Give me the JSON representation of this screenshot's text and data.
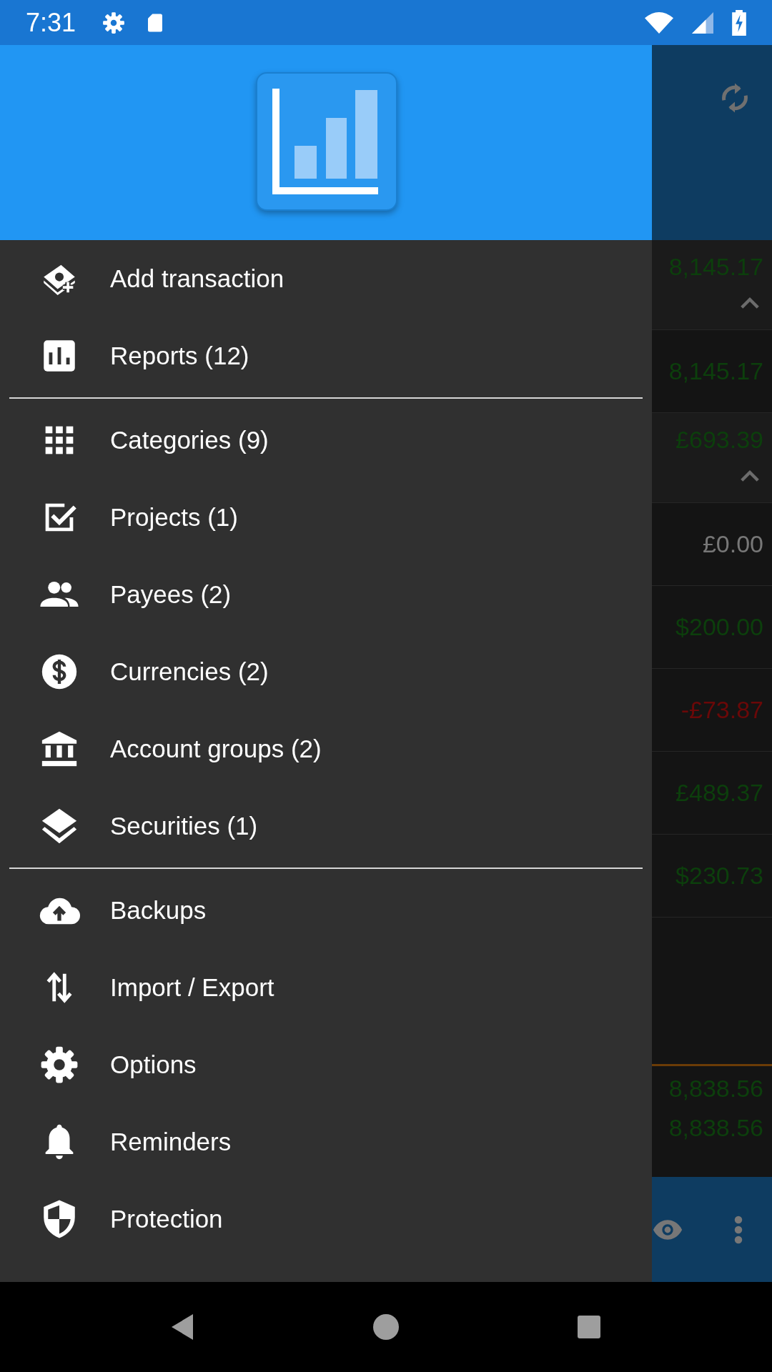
{
  "status_bar": {
    "time": "7:31"
  },
  "drawer": {
    "sections": [
      [
        {
          "label": "Add transaction"
        },
        {
          "label": "Reports (12)"
        }
      ],
      [
        {
          "label": "Categories (9)"
        },
        {
          "label": "Projects (1)"
        },
        {
          "label": "Payees (2)"
        },
        {
          "label": "Currencies (2)"
        },
        {
          "label": "Account groups (2)"
        },
        {
          "label": "Securities (1)"
        }
      ],
      [
        {
          "label": "Backups"
        },
        {
          "label": "Import / Export"
        },
        {
          "label": "Options"
        },
        {
          "label": "Reminders"
        },
        {
          "label": "Protection"
        }
      ]
    ]
  },
  "background": {
    "rows": [
      {
        "kind": "group",
        "amount": "8,145.17",
        "color": "#0c3f0c",
        "expanded": true
      },
      {
        "kind": "account",
        "amount": "8,145.17",
        "color": "#0c3f0c"
      },
      {
        "kind": "group",
        "amount": "£693.39",
        "color": "#0c3f0c",
        "expanded": true
      },
      {
        "kind": "account",
        "amount": "£0.00",
        "color": "#777777"
      },
      {
        "kind": "account",
        "amount": "$200.00",
        "color": "#0c3f0c"
      },
      {
        "kind": "account",
        "amount": "-£73.87",
        "color": "#6a0808"
      },
      {
        "kind": "account",
        "amount": "£489.37",
        "color": "#0c3f0c"
      },
      {
        "kind": "account",
        "amount": "$230.73",
        "color": "#0c3f0c"
      }
    ],
    "totals": [
      {
        "amount": "8,838.56",
        "color": "#0c3f0c"
      },
      {
        "amount": "8,838.56",
        "color": "#0c3f0c"
      }
    ]
  }
}
